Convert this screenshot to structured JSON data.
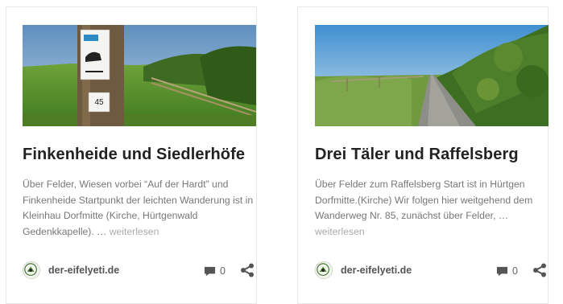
{
  "cards": [
    {
      "title": "Finkenheide und Siedlerhöfe",
      "excerpt": "Über Felder, Wiesen vorbei “Auf der Hardt” und  Finkenheide Startpunkt der leichten Wanderung ist in Kleinhau Dorfmitte (Kirche, Hürtgenwald Gedenkkapelle). … ",
      "more": "weiterlesen",
      "sign_number": "45",
      "author": "der-eifelyeti.de",
      "comments": "0",
      "icons": {
        "comment": "comment-icon",
        "share": "share-icon",
        "avatar": "avatar-logo"
      }
    },
    {
      "title": "Drei Täler und Raffelsberg",
      "excerpt": "Über Felder zum Raffelsberg Start ist in Hürtgen Dorfmitte.(Kirche) Wir folgen hier weitgehend dem Wanderweg Nr. 85, zunächst über Felder, … ",
      "more": "weiterlesen",
      "author": "der-eifelyeti.de",
      "comments": "0",
      "icons": {
        "comment": "comment-icon",
        "share": "share-icon",
        "avatar": "avatar-logo"
      }
    }
  ],
  "colors": {
    "title": "#222222",
    "excerpt": "#777777",
    "more": "#aaaaaa",
    "meta": "#555555",
    "icon": "#555555",
    "border": "#e6e6e6"
  }
}
